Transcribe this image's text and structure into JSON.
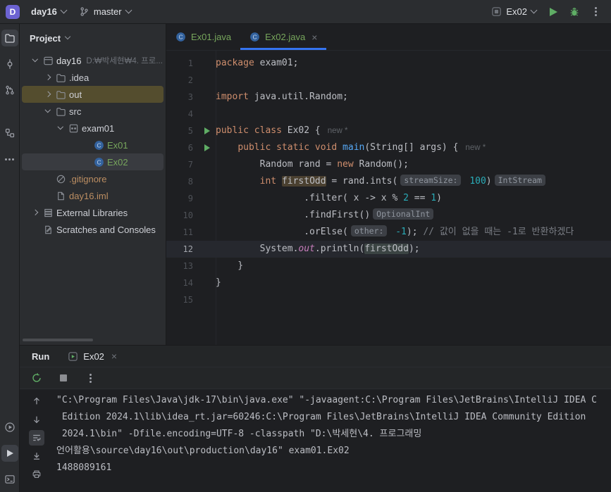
{
  "header": {
    "project_badge": "D",
    "project_name": "day16",
    "branch": "master",
    "run_config": "Ex02"
  },
  "project_panel": {
    "title": "Project",
    "items": [
      {
        "id": "day16",
        "label": "day16",
        "hint": "D:₩박세현₩4. 프로...",
        "depth": 0,
        "chevron": "down",
        "icon": "project",
        "color": "main"
      },
      {
        "id": "idea",
        "label": ".idea",
        "depth": 1,
        "chevron": "right",
        "icon": "folder"
      },
      {
        "id": "out",
        "label": "out",
        "depth": 1,
        "chevron": "right",
        "icon": "folder",
        "row": "excluded"
      },
      {
        "id": "src",
        "label": "src",
        "depth": 1,
        "chevron": "down",
        "icon": "folder"
      },
      {
        "id": "exam01",
        "label": "exam01",
        "depth": 2,
        "chevron": "down",
        "icon": "package"
      },
      {
        "id": "ex01",
        "label": "Ex01",
        "depth": 3,
        "chevron": "none",
        "icon": "class",
        "color": "added"
      },
      {
        "id": "ex02",
        "label": "Ex02",
        "depth": 3,
        "chevron": "none",
        "icon": "class",
        "color": "added",
        "row": "selected"
      },
      {
        "id": "gitignore",
        "label": ".gitignore",
        "depth": 1,
        "chevron": "none",
        "icon": "ignored",
        "color": "tan"
      },
      {
        "id": "day16-iml",
        "label": "day16.iml",
        "depth": 1,
        "chevron": "none",
        "icon": "file",
        "color": "tan"
      },
      {
        "id": "external-libraries",
        "label": "External Libraries",
        "depth": 0,
        "chevron": "right",
        "icon": "libs"
      },
      {
        "id": "scratches",
        "label": "Scratches and Consoles",
        "depth": 0,
        "chevron": "none",
        "icon": "scratch"
      }
    ]
  },
  "editor": {
    "tabs": [
      {
        "label": "Ex01.java",
        "active": false
      },
      {
        "label": "Ex02.java",
        "close": "×",
        "active": true
      }
    ],
    "lines": [
      {
        "num": "1",
        "segs": [
          [
            "kw",
            "package"
          ],
          [
            "t",
            " exam01;"
          ]
        ]
      },
      {
        "num": "2",
        "segs": []
      },
      {
        "num": "3",
        "segs": [
          [
            "kw",
            "import"
          ],
          [
            "t",
            " java.util.Random;"
          ]
        ]
      },
      {
        "num": "4",
        "segs": []
      },
      {
        "num": "5",
        "run": true,
        "segs": [
          [
            "kw",
            "public"
          ],
          [
            "t",
            " "
          ],
          [
            "kw",
            "class"
          ],
          [
            "t",
            " Ex02 {"
          ],
          [
            "hint",
            "new *"
          ]
        ]
      },
      {
        "num": "6",
        "run": true,
        "segs": [
          [
            "t",
            "    "
          ],
          [
            "kw",
            "public"
          ],
          [
            "t",
            " "
          ],
          [
            "kw",
            "static"
          ],
          [
            "t",
            " "
          ],
          [
            "kw",
            "void"
          ],
          [
            "t",
            " "
          ],
          [
            "fn",
            "main"
          ],
          [
            "t",
            "(String[] args) {"
          ],
          [
            "hint",
            "new *"
          ]
        ]
      },
      {
        "num": "7",
        "segs": [
          [
            "t",
            "        Random rand = "
          ],
          [
            "kw",
            "new"
          ],
          [
            "t",
            " Random();"
          ]
        ]
      },
      {
        "num": "8",
        "segs": [
          [
            "t",
            "        "
          ],
          [
            "kw",
            "int"
          ],
          [
            "t",
            " "
          ],
          [
            "hlw",
            "firstOdd"
          ],
          [
            "t",
            " = rand.ints("
          ],
          [
            "chip",
            "streamSize:"
          ],
          [
            "t",
            " "
          ],
          [
            "num",
            "100"
          ],
          [
            "t",
            ")"
          ],
          [
            "chip",
            "IntStream"
          ]
        ]
      },
      {
        "num": "9",
        "segs": [
          [
            "t",
            "                .filter( x -> x % "
          ],
          [
            "num",
            "2"
          ],
          [
            "t",
            " == "
          ],
          [
            "num",
            "1"
          ],
          [
            "t",
            ")"
          ]
        ]
      },
      {
        "num": "10",
        "segs": [
          [
            "t",
            "                .findFirst()"
          ],
          [
            "chip",
            "OptionalInt"
          ]
        ]
      },
      {
        "num": "11",
        "segs": [
          [
            "t",
            "                .orElse("
          ],
          [
            "chip",
            "other:"
          ],
          [
            "t",
            " "
          ],
          [
            "num",
            "-1"
          ],
          [
            "t",
            "); "
          ],
          [
            "cmt",
            "// 값이 없을 때는 -1로 반환하겠다"
          ]
        ]
      },
      {
        "num": "12",
        "current": true,
        "segs": [
          [
            "t",
            "        System."
          ],
          [
            "fld",
            "out"
          ],
          [
            "t",
            ".println("
          ],
          [
            "hlr",
            "firstOdd"
          ],
          [
            "t",
            ");"
          ]
        ]
      },
      {
        "num": "13",
        "segs": [
          [
            "t",
            "    }"
          ]
        ]
      },
      {
        "num": "14",
        "segs": [
          [
            "t",
            "}"
          ]
        ]
      },
      {
        "num": "15",
        "segs": []
      }
    ]
  },
  "run_panel": {
    "title": "Run",
    "tab_label": "Ex02",
    "tab_close": "×",
    "console_lines": [
      "\"C:\\Program Files\\Java\\jdk-17\\bin\\java.exe\" \"-javaagent:C:\\Program Files\\JetBrains\\IntelliJ IDEA C",
      " Edition 2024.1\\lib\\idea_rt.jar=60246:C:\\Program Files\\JetBrains\\IntelliJ IDEA Community Edition",
      " 2024.1\\bin\" -Dfile.encoding=UTF-8 -classpath \"D:\\박세현\\4. 프로그래밍",
      "언어활용\\source\\day16\\out\\production\\day16\" exam01.Ex02",
      "1488089161"
    ]
  },
  "colors": {
    "accent": "#3574f0",
    "run_green": "#5fad65",
    "vcs_added": "#77a65c",
    "unversioned_tan": "#bc8e62",
    "excluded_row_bg": "#544d2e",
    "selected_row_bg": "#393b40",
    "keyword": "#cf8e6d",
    "number": "#2aacb8",
    "method": "#56a8f5",
    "field": "#c77dbb",
    "comment": "#7a7e85",
    "current_line_bg": "#26282e"
  }
}
